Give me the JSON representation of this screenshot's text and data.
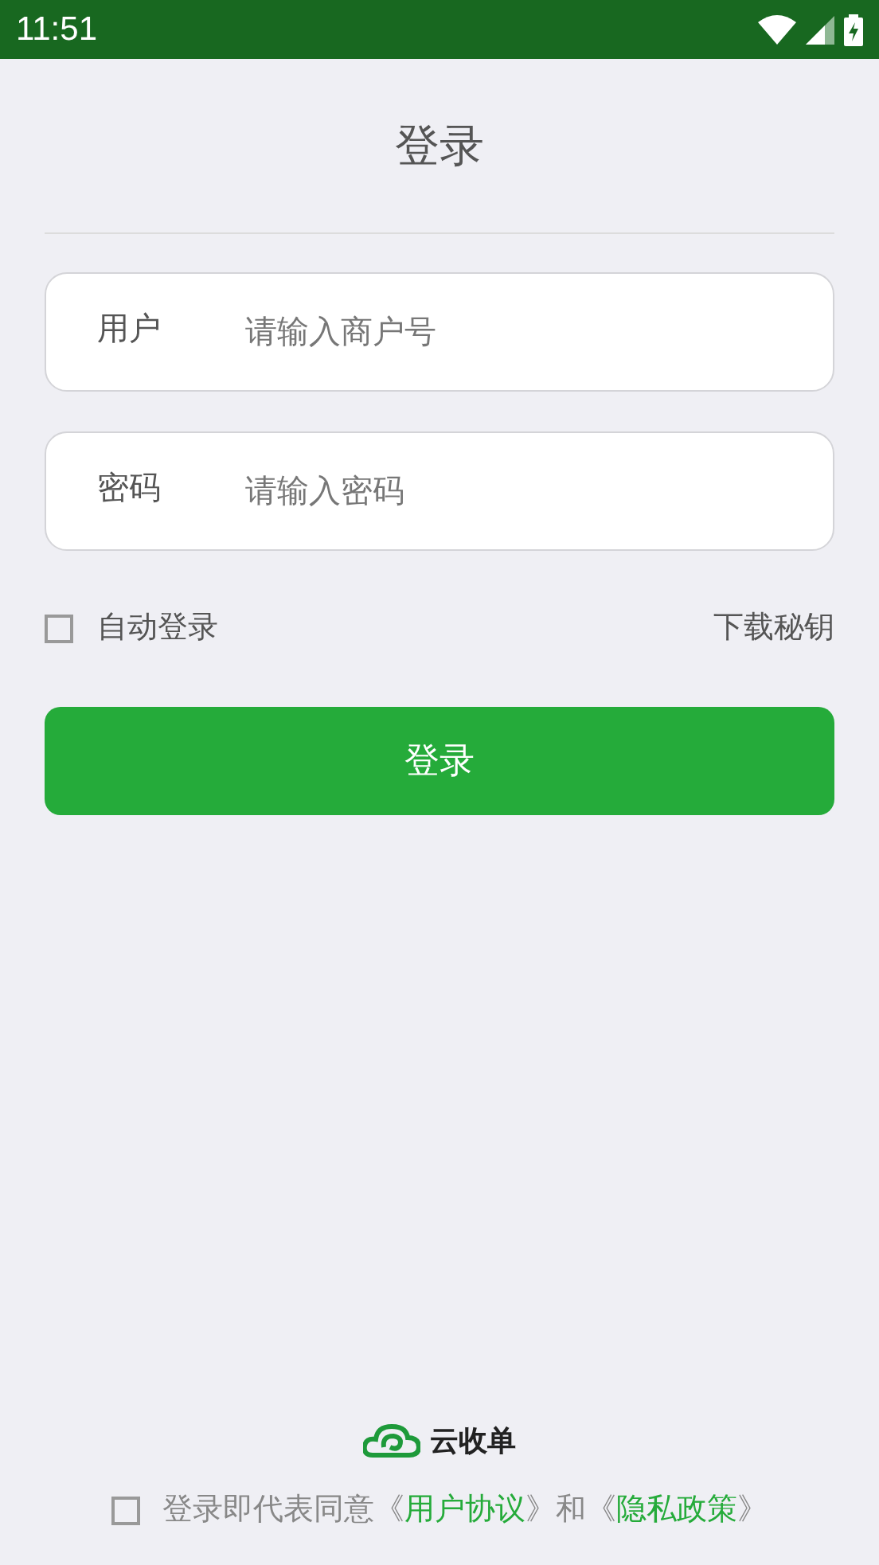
{
  "status_bar": {
    "time": "11:51"
  },
  "title": "登录",
  "fields": [
    {
      "label": "用户",
      "placeholder": "请输入商户号"
    },
    {
      "label": "密码",
      "placeholder": "请输入密码"
    }
  ],
  "auto_login": {
    "label": "自动登录",
    "checked": false
  },
  "download_key": "下载秘钥",
  "login_button": "登录",
  "brand": "云收单",
  "agreement": {
    "checked": false,
    "prefix": "登录即代表同意《",
    "link_1": "用户协议",
    "middle": "》和《",
    "link_2": "隐私政策",
    "suffix": "》"
  }
}
